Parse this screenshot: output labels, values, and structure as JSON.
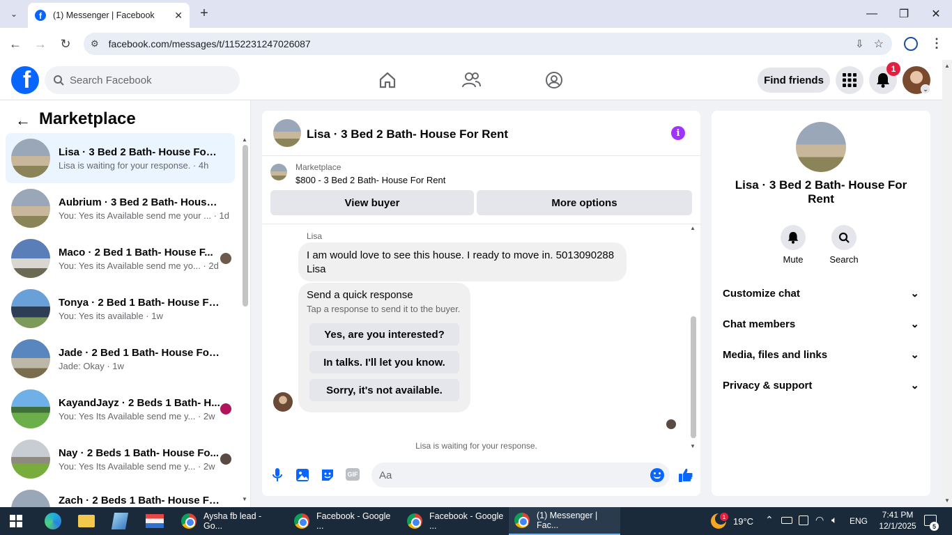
{
  "browser": {
    "tab_title": "(1) Messenger | Facebook",
    "url": "facebook.com/messages/t/1152231247026087"
  },
  "fb_header": {
    "search_placeholder": "Search Facebook",
    "find_friends": "Find friends",
    "notification_count": "1"
  },
  "sidebar": {
    "title": "Marketplace",
    "conversations": [
      {
        "title": "Lisa · 3 Bed 2 Bath- House For R...",
        "subtitle": "Lisa is waiting for your response. · 4h"
      },
      {
        "title": "Aubrium · 3 Bed 2 Bath- House ...",
        "subtitle": "You: Yes its Available send me your ... · 1d"
      },
      {
        "title": "Maco · 2 Bed 1 Bath- House F...",
        "subtitle": "You: Yes its Available send me yo... · 2d"
      },
      {
        "title": "Tonya · 2 Bed 1 Bath- House For ...",
        "subtitle": "You: Yes its available · 1w"
      },
      {
        "title": "Jade · 2 Bed 1 Bath- House For R...",
        "subtitle": "Jade: Okay · 1w"
      },
      {
        "title": "KayandJayz · 2 Beds 1 Bath- H...",
        "subtitle": "You: Yes Its Available send me y... · 2w"
      },
      {
        "title": "Nay · 2 Beds 1 Bath- House Fo...",
        "subtitle": "You: Yes Its Available send me y... · 2w"
      },
      {
        "title": "Zach · 2 Beds 1 Bath- House For ...",
        "subtitle": ""
      }
    ]
  },
  "chat": {
    "title": "Lisa · 3 Bed 2 Bath- House For Rent",
    "listing_source": "Marketplace",
    "listing_title": "$800 - 3 Bed 2 Bath- House For Rent",
    "view_buyer": "View buyer",
    "more_options": "More options",
    "sender_name": "Lisa",
    "message_text": "I am would love to see this house. I ready to move in. 5013090288 Lisa",
    "quick_title": "Send a quick response",
    "quick_subtitle": "Tap a response to send it to the buyer.",
    "quick_options": [
      "Yes, are you interested?",
      "In talks. I'll let you know.",
      "Sorry, it's not available."
    ],
    "status_text": "Lisa is waiting for your response.",
    "composer_placeholder": "Aa"
  },
  "info_panel": {
    "title": "Lisa · 3 Bed 2 Bath- House For Rent",
    "mute_label": "Mute",
    "search_label": "Search",
    "sections": [
      "Customize chat",
      "Chat members",
      "Media, files and links",
      "Privacy & support"
    ]
  },
  "taskbar": {
    "items": [
      "Aysha fb lead - Go...",
      "Facebook - Google ...",
      "Facebook - Google ...",
      "(1) Messenger | Fac..."
    ],
    "weather": "19°C",
    "weather_badge": "1",
    "language": "ENG",
    "time": "7:41 PM",
    "date": "12/1/2025",
    "notification_count": "5"
  },
  "colors": {
    "fb_blue": "#0866ff",
    "accent_purple": "#a033ff",
    "notify_red": "#e41e3f",
    "taskbar": "#1b2a3a"
  }
}
